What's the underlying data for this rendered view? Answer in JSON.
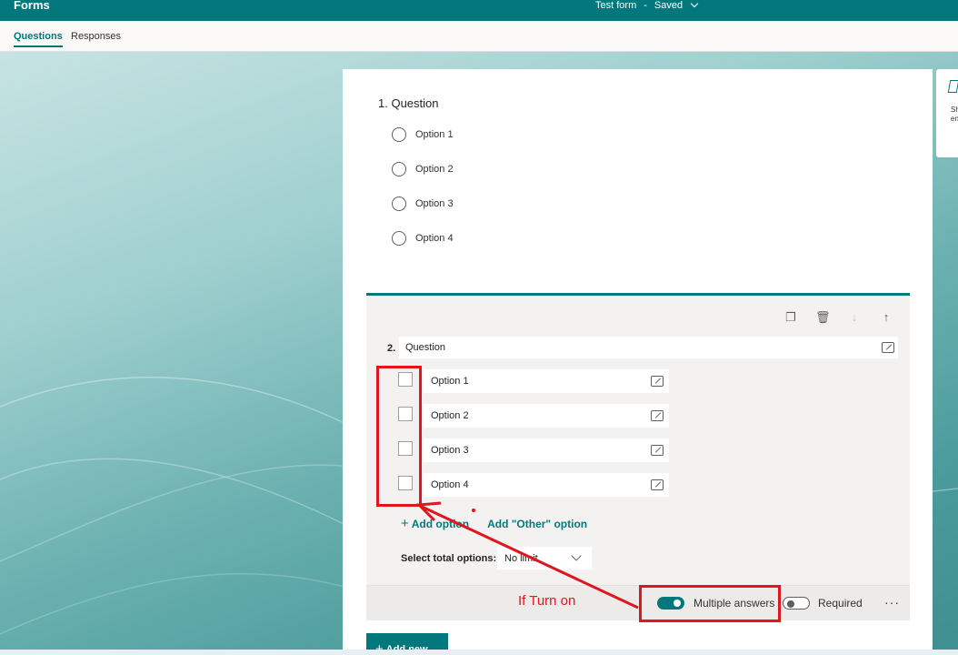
{
  "app": {
    "title": "Forms"
  },
  "form": {
    "name": "Test form",
    "separator": "-",
    "status": "Saved"
  },
  "tabs": [
    {
      "label": "Questions",
      "active": true
    },
    {
      "label": "Responses",
      "active": false
    }
  ],
  "question1": {
    "title": "1. Question",
    "options": [
      "Option 1",
      "Option 2",
      "Option 3",
      "Option 4"
    ]
  },
  "question2": {
    "number": "2.",
    "title": "Question",
    "options": [
      "Option 1",
      "Option 2",
      "Option 3",
      "Option 4"
    ],
    "add_option": "Add option",
    "add_other": "Add \"Other\" option",
    "select_total_label": "Select total options:",
    "select_total_value": "No limit",
    "multiple_answers_label": "Multiple answers",
    "multiple_answers_on": true,
    "required_label": "Required",
    "required_on": false,
    "more_label": "···"
  },
  "add_new": "Add new",
  "side_panel": {
    "text_line1": "Sh",
    "text_line2": "en"
  },
  "annotation": {
    "text": "If Turn on",
    "color": "#e0161f"
  },
  "colors": {
    "accent": "#03787c",
    "annotation": "#e0161f"
  }
}
